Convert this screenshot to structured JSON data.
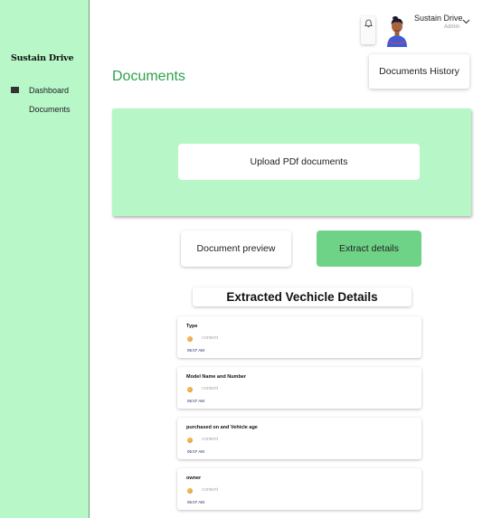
{
  "brand": "Sustain Drive",
  "sidebar": {
    "items": [
      {
        "label": "Dashboard",
        "icon": "dashboard-grid-icon"
      },
      {
        "label": "Documents",
        "icon": ""
      }
    ]
  },
  "header": {
    "user_name": "Sustain Drive",
    "user_role": "Admin",
    "history_button": "Documents History"
  },
  "page_title": "Documents",
  "upload_button": "Upload PDf documents",
  "actions": {
    "preview": "Document preview",
    "extract": "Extract details"
  },
  "details_title": "Extracted Vechicle Details",
  "cards": [
    {
      "label": "Type",
      "value": "content",
      "time": "06:07 AM"
    },
    {
      "label": "Model Name and Number",
      "value": "content",
      "time": "06:07 AM"
    },
    {
      "label": "purchased on and Vehicle age",
      "value": "content",
      "time": "06:07 AM"
    },
    {
      "label": "owner",
      "value": "content",
      "time": "06:07 AM"
    }
  ],
  "colors": {
    "sidebar_bg": "#b8f7c8",
    "accent_green": "#2fa14a",
    "extract_button": "#6ed386"
  }
}
